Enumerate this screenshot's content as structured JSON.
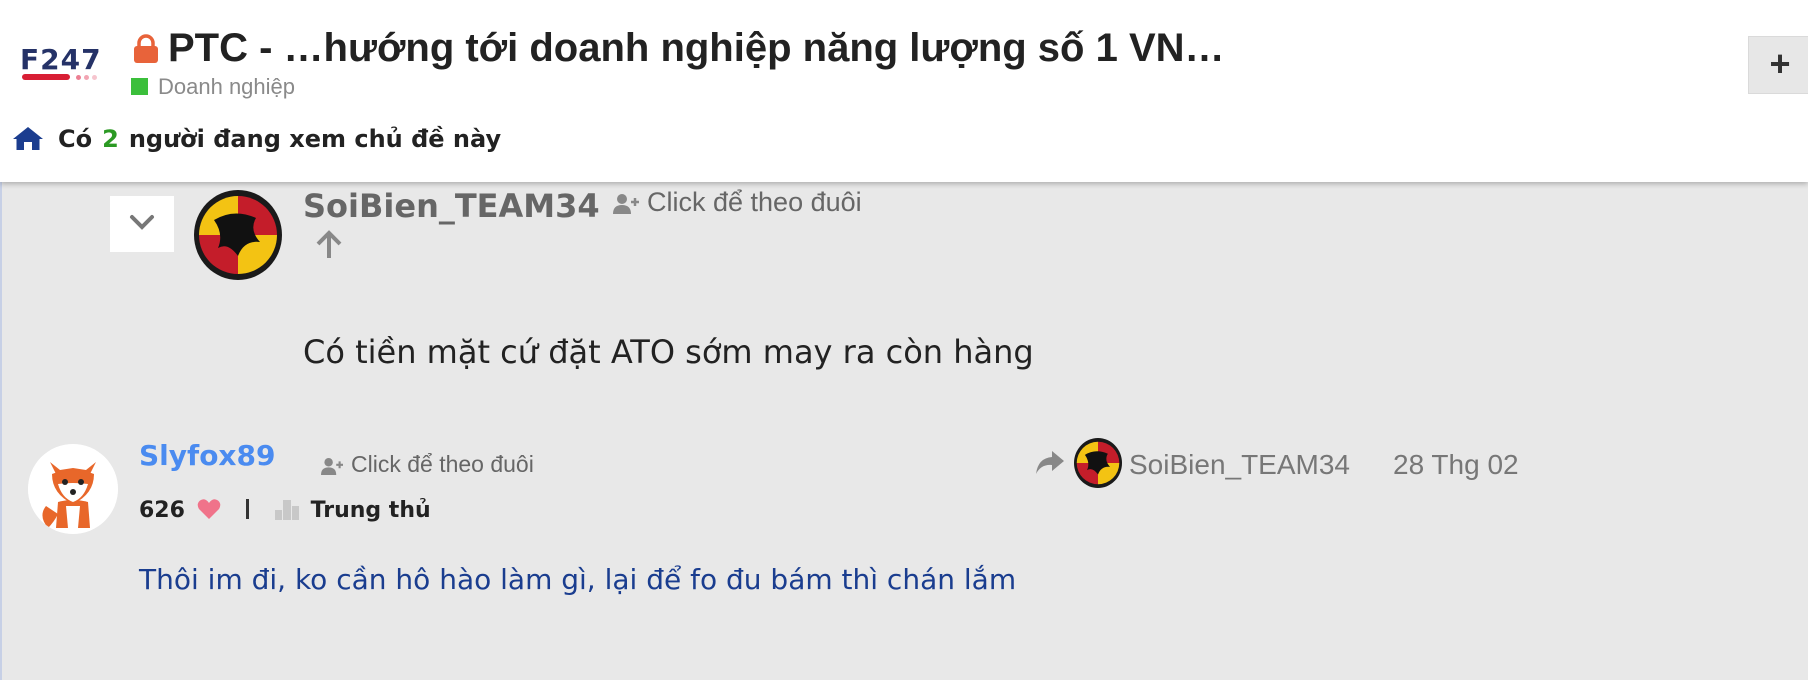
{
  "header": {
    "logo_text": "F247",
    "title": "PTC - …hướng tới doanh nghiệp năng lượng số 1 VN…",
    "category": "Doanh nghiệp",
    "category_color": "#3bbf3b",
    "lock_color": "#e8633a",
    "plus_label": "+",
    "viewers_prefix": "Có",
    "viewers_count": "2",
    "viewers_suffix": "người đang xem chủ đề này"
  },
  "quoted_post": {
    "author": "SoiBien_TEAM34",
    "follow_label": "Click để theo đuôi",
    "text": "Có tiền mặt cứ đặt ATO sớm may ra còn hàng"
  },
  "reply_post": {
    "author": "Slyfox89",
    "author_color": "#4a8bf0",
    "follow_label": "Click để theo đuôi",
    "likes": "626",
    "rank": "Trung thủ",
    "reply_to_user": "SoiBien_TEAM34",
    "date": "28 Thg 02",
    "text": "Thôi im đi, ko cần hô hào làm gì, lại để fo đu bám thì chán lắm"
  },
  "icons": [
    "lock-icon",
    "home-icon",
    "chevron-down-icon",
    "add-user-icon",
    "arrow-up-icon",
    "heart-icon",
    "rank-icon",
    "reply-arrow-icon",
    "plus-icon"
  ]
}
